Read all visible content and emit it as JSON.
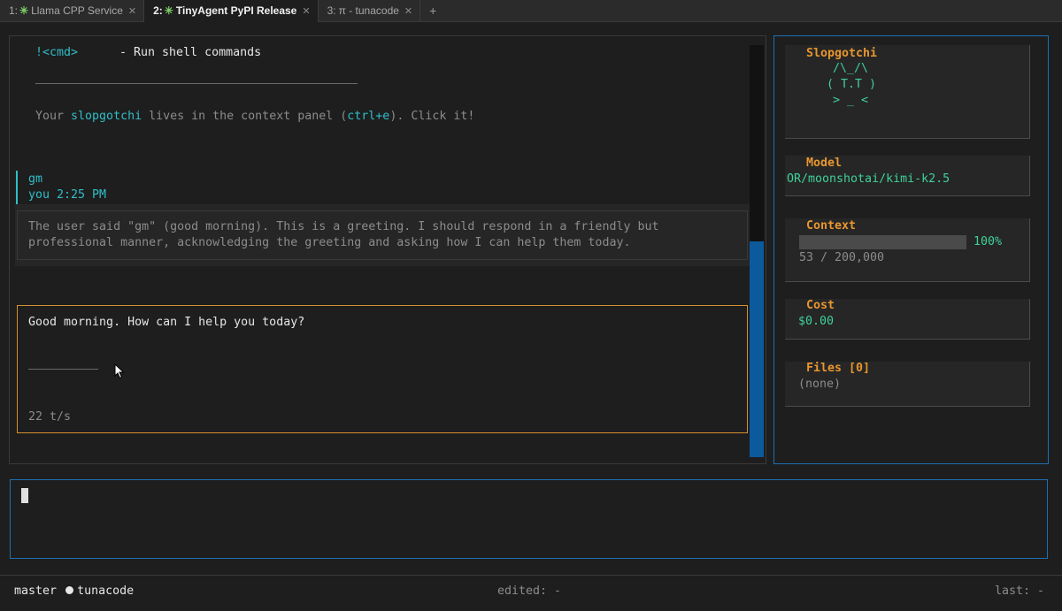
{
  "tabs": [
    {
      "prefix": "1:",
      "title": "Llama CPP Service",
      "active": false,
      "has_star": true
    },
    {
      "prefix": "2:",
      "title": "TinyAgent PyPI Release",
      "active": true,
      "has_star": true
    },
    {
      "prefix": "3:",
      "title": "π - tunacode",
      "active": false,
      "has_star": false
    }
  ],
  "tab_add": "+",
  "chat": {
    "cmd_key": "!<cmd>",
    "cmd_desc": "- Run shell commands",
    "hint_prefix": "Your ",
    "hint_pet": "slopgotchi",
    "hint_middle": " lives in the context panel (",
    "hint_shortcut": "ctrl+e",
    "hint_suffix": "). Click it!",
    "user_message": "gm",
    "user_meta": "you 2:25 PM",
    "thinking_line1": "The user said \"gm\" (good morning). This is a greeting. I should respond in a friendly but",
    "thinking_line2": "professional manner, acknowledging the greeting and asking how I can help them today.",
    "assistant_reply": "Good morning. How can I help you today?",
    "tokens_per_sec": "22 t/s"
  },
  "context_panel": {
    "pet_title": "Slopgotchi",
    "pet_art": [
      "/\\_/\\",
      "( T.T )",
      "> _ <"
    ],
    "model_title": "Model",
    "model_value": "OR/moonshotai/kimi-k2.5",
    "context_title": "Context",
    "context_percent_label": "100%",
    "context_fill": 1.0,
    "context_tokens": "53 / 200,000",
    "cost_title": "Cost",
    "cost_value": "$0.00",
    "files_title": "Files [0]",
    "files_value": "(none)"
  },
  "status_bar": {
    "branch": "master",
    "project": "tunacode",
    "edited": "edited: -",
    "last": "last: -"
  },
  "colors": {
    "accent_teal": "#2fbfc9",
    "accent_orange": "#e8962f",
    "accent_green": "#3fd19a",
    "panel_border_blue": "#1e6fb3"
  }
}
